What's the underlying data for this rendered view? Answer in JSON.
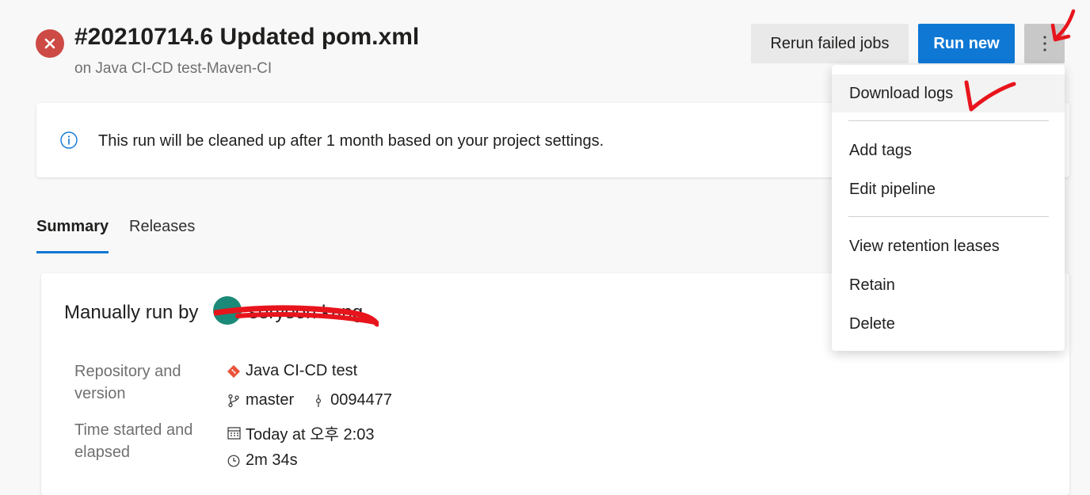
{
  "header": {
    "title": "#20210714.6 Updated pom.xml",
    "subtitle": "on Java CI-CD test-Maven-CI",
    "status": "failed",
    "status_color": "#cd4a45"
  },
  "toolbar": {
    "rerun_label": "Rerun failed jobs",
    "run_new_label": "Run new",
    "more_icon": "more-vertical-icon"
  },
  "banner": {
    "text": "This run will be cleaned up after 1 month based on your project settings."
  },
  "tabs": [
    {
      "label": "Summary",
      "selected": true
    },
    {
      "label": "Releases",
      "selected": false
    }
  ],
  "summary": {
    "manually_run_by": "Manually run by",
    "user_name": "seryeon kang",
    "rows": [
      {
        "label": "Repository and version",
        "values": [
          "Java CI-CD test"
        ]
      },
      {
        "branch": "master",
        "commit": "0094477"
      },
      {
        "label": "Time started and elapsed",
        "values": [
          "Today at 오후 2:03"
        ]
      },
      {
        "elapsed": "2m 34s"
      }
    ],
    "repository": "Java CI-CD test",
    "branch": "master",
    "commit": "0094477",
    "started": "Today at 오후 2:03",
    "elapsed": "2m 34s",
    "repo_label": "Repository and version",
    "time_label": "Time started and elapsed"
  },
  "menu": {
    "items": [
      {
        "label": "Download logs",
        "hovered": true
      },
      {
        "label": "Add tags"
      },
      {
        "label": "Edit pipeline"
      },
      {
        "label": "View retention leases"
      },
      {
        "label": "Retain"
      },
      {
        "label": "Delete"
      }
    ]
  },
  "colors": {
    "accent": "#0f78d4",
    "annotation": "#e8141c",
    "avatar": "#1c8a78"
  }
}
